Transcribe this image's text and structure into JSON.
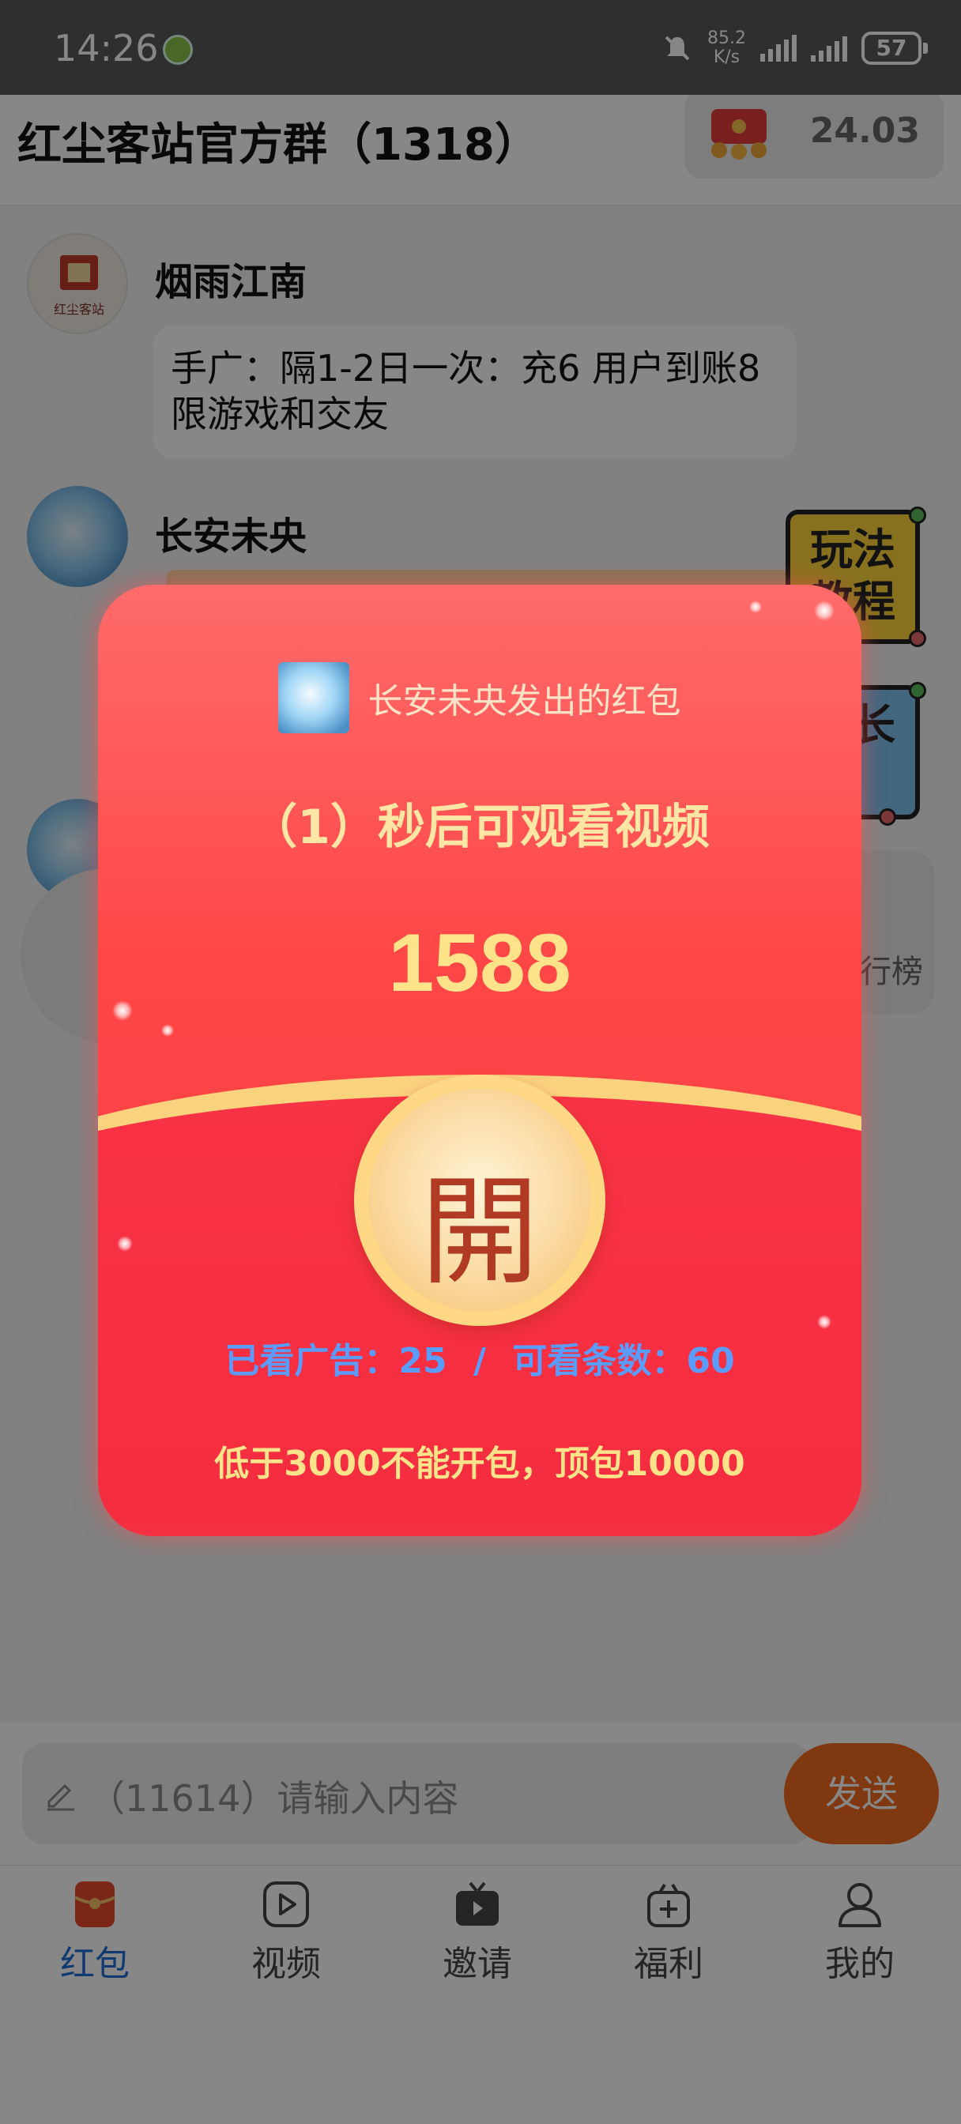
{
  "status_bar": {
    "time": "14:26",
    "net_speed_value": "85.2",
    "net_speed_unit": "K/s",
    "battery": "57"
  },
  "header": {
    "title": "红尘客站官方群（1318）",
    "balance": "24.03"
  },
  "chat": {
    "messages": [
      {
        "sender": "烟雨江南",
        "text": "手广：隔1-2日一次：充6  用户到账8 限游戏和交友"
      },
      {
        "sender": "长安未央"
      }
    ],
    "avatar_text": "红尘客站",
    "float_buttons": [
      {
        "label": "玩法教程"
      },
      {
        "label": "级长"
      }
    ],
    "side_right_label": "行榜"
  },
  "input": {
    "placeholder": "（11614）请输入内容",
    "send_label": "发送"
  },
  "tabs": [
    {
      "label": "红包",
      "icon": "red-packet-icon",
      "active": true
    },
    {
      "label": "视频",
      "icon": "video-play-icon",
      "active": false
    },
    {
      "label": "邀请",
      "icon": "tv-icon",
      "active": false
    },
    {
      "label": "福利",
      "icon": "gift-box-icon",
      "active": false
    },
    {
      "label": "我的",
      "icon": "user-icon",
      "active": false
    }
  ],
  "packet": {
    "sender_line": "长安未央发出的红包",
    "countdown": "（1）秒后可观看视频",
    "amount": "1588",
    "open_char": "開",
    "watched_label": "已看广告：",
    "watched": "25",
    "sep": "/",
    "available_label": "可看条数：",
    "available": "60",
    "note": "低于3000不能开包，顶包10000"
  },
  "colors": {
    "accent_blue": "#1f6fd6",
    "send_orange": "#f06a1e",
    "packet_red": "#f53a45",
    "packet_gold": "#fbd27e"
  }
}
